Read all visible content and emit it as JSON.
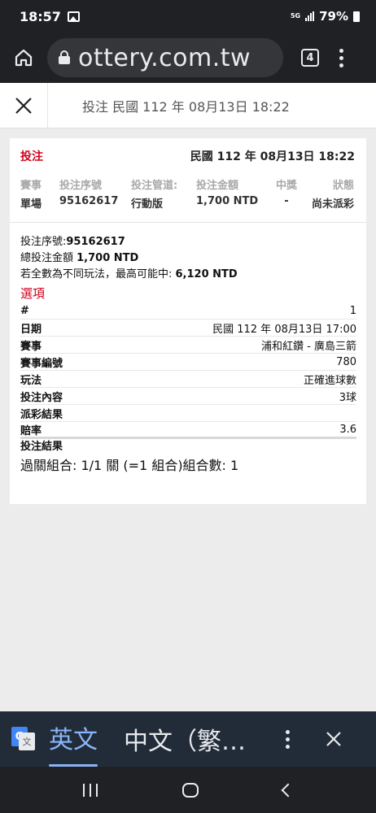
{
  "status_bar": {
    "time": "18:57",
    "network": "5G",
    "battery": "79%"
  },
  "browser": {
    "url": "ottery.com.tw",
    "tab_count": "4"
  },
  "header": {
    "title": "投注 民國 112 年 08月13日 18:22"
  },
  "bet": {
    "label": "投注",
    "date": "民國 112 年 08月13日 18:22",
    "summary_headers": [
      "賽事",
      "投注序號",
      "投注管道:",
      "投注金額",
      "中獎",
      "狀態"
    ],
    "summary_values": [
      "單場",
      "95162617",
      "行動版",
      "1,700 NTD",
      "-",
      "尚未派彩"
    ],
    "serial_label": "投注序號:",
    "serial_value": "95162617",
    "total_label": "總投注金額 ",
    "total_value": "1,700 NTD",
    "max_label": "若全數為不同玩法，最高可能中: ",
    "max_value": "6,120 NTD",
    "options_title": "選項",
    "rows": [
      {
        "key": "#",
        "value": "1"
      },
      {
        "key": "日期",
        "value": "民國 112 年 08月13日 17:00"
      },
      {
        "key": "賽事",
        "value": "浦和紅鑽 - 廣島三箭"
      },
      {
        "key": "賽事編號",
        "value": "780"
      },
      {
        "key": "玩法",
        "value": "正確進球數"
      },
      {
        "key": "投注內容",
        "value": "3球"
      },
      {
        "key": "派彩結果",
        "value": ""
      },
      {
        "key": "賠率",
        "value": "3.6"
      }
    ],
    "result_label": "投注結果",
    "combo": "過關組合: 1/1 關 (=1 組合)組合數: 1"
  },
  "translate": {
    "lang_en": "英文",
    "lang_zh": "中文（繁體）"
  }
}
